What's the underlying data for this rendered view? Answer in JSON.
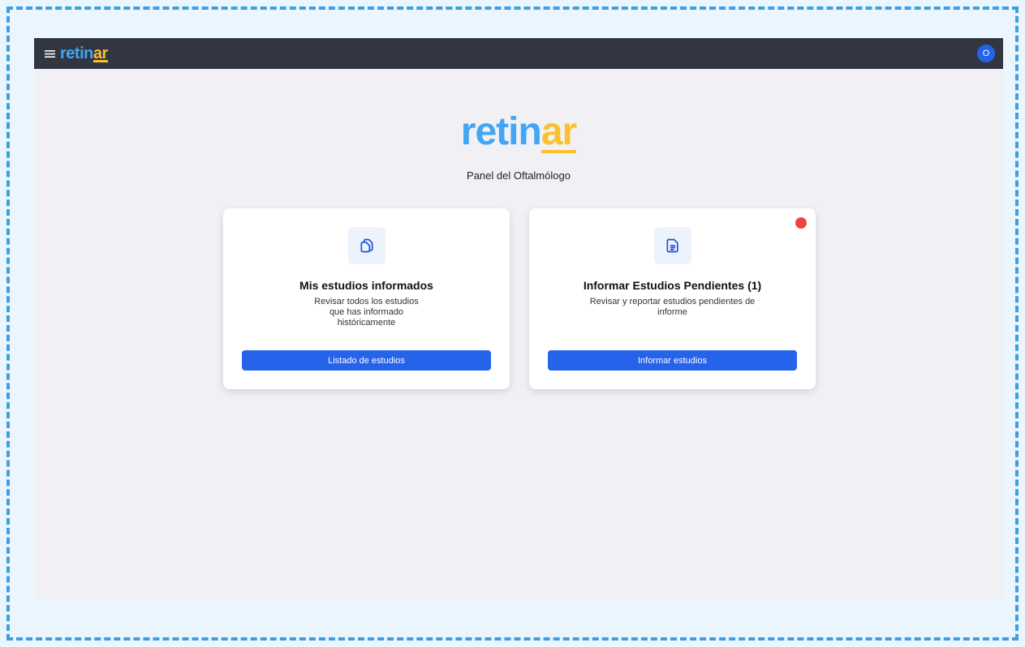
{
  "header": {
    "logo_part1": "retin",
    "logo_part2": "ar",
    "avatar_initial": "O"
  },
  "hero": {
    "logo_part1": "retin",
    "logo_part2": "ar",
    "subtitle": "Panel del Oftalmólogo"
  },
  "cards": [
    {
      "icon": "documents-copy-icon",
      "title": "Mis estudios informados",
      "description": "Revisar todos los estudios que has informado históricamente",
      "button_label": "Listado de estudios"
    },
    {
      "icon": "document-text-icon",
      "title": "Informar Estudios Pendientes (1)",
      "description": "Revisar y reportar estudios pendientes de informe",
      "button_label": "Informar estudios",
      "notification": true
    }
  ],
  "colors": {
    "brand_blue": "#42a5f5",
    "brand_yellow": "#fbc02d",
    "primary_button": "#2563eb",
    "topbar": "#323640",
    "notification": "#ef4444"
  }
}
